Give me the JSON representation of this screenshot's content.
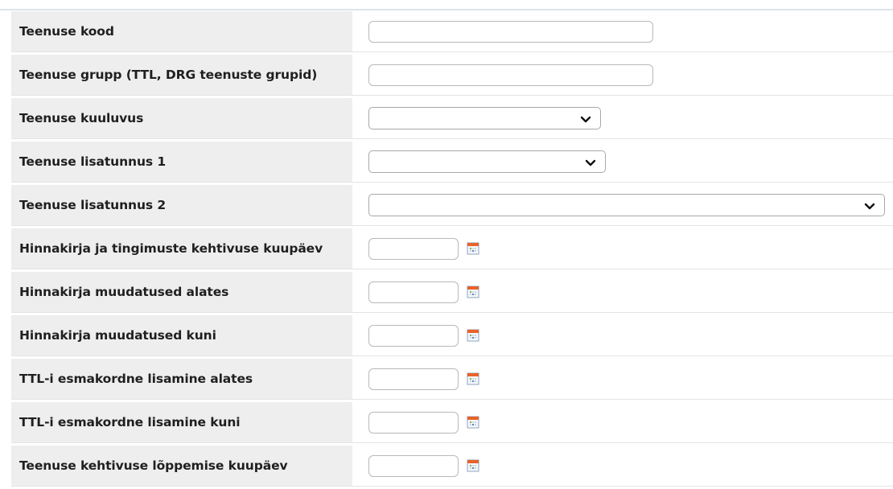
{
  "form": {
    "rows": [
      {
        "label": "Teenuse kood",
        "type": "text",
        "value": ""
      },
      {
        "label": "Teenuse grupp (TTL, DRG teenuste grupid)",
        "type": "text",
        "value": ""
      },
      {
        "label": "Teenuse kuuluvus",
        "type": "select",
        "value": ""
      },
      {
        "label": "Teenuse lisatunnus 1",
        "type": "select",
        "value": ""
      },
      {
        "label": "Teenuse lisatunnus 2",
        "type": "select",
        "value": ""
      },
      {
        "label": "Hinnakirja ja tingimuste kehtivuse kuupäev",
        "type": "date",
        "value": ""
      },
      {
        "label": "Hinnakirja muudatused alates",
        "type": "date",
        "value": ""
      },
      {
        "label": "Hinnakirja muudatused kuni",
        "type": "date",
        "value": ""
      },
      {
        "label": "TTL-i esmakordne lisamine alates",
        "type": "date",
        "value": ""
      },
      {
        "label": "TTL-i esmakordne lisamine kuni",
        "type": "date",
        "value": ""
      },
      {
        "label": "Teenuse kehtivuse lõppemise kuupäev",
        "type": "date",
        "value": ""
      }
    ]
  },
  "icons": {
    "select_arrow": "chevron-down-icon",
    "date_picker": "calendar-icon"
  },
  "colors": {
    "label_background": "#eeeeee",
    "border": "#b9b9b9",
    "calendar_accent": "#e8632a"
  }
}
